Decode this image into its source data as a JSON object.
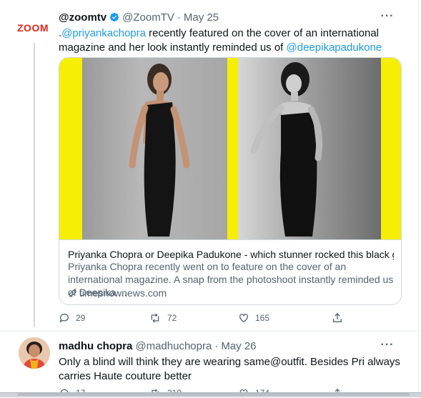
{
  "tweet": {
    "display_name": "@zoomtv",
    "handle": "@ZoomTV",
    "date": "May 25",
    "avatar_text": "ZOOM",
    "text_parts": [
      {
        "text": ".",
        "type": "plain"
      },
      {
        "text": "@priyankachopra",
        "type": "mention"
      },
      {
        "text": " recently featured on the cover of an international magazine and her look instantly reminded us of ",
        "type": "plain"
      },
      {
        "text": "@deepikapadukone",
        "type": "mention"
      }
    ],
    "card": {
      "title": "Priyanka Chopra or Deepika Padukone - which stunner rocked this black gow...",
      "description": "Priyanka Chopra recently went on to feature on the cover of an international magazine. A snap from the photoshoot instantly reminded us of Deepika ...",
      "domain": "timesnownews.com"
    },
    "actions": {
      "replies": "29",
      "retweets": "72",
      "likes": "165"
    }
  },
  "reply": {
    "display_name": "madhu chopra",
    "handle": "@madhuchopra",
    "date": "May 26",
    "text": "Only a blind will think they are wearing same@outfit. Besides Pri always carries Haute couture better",
    "actions": {
      "replies": "17",
      "retweets": "210",
      "likes": "174"
    }
  },
  "more_label": "···",
  "separator": "·",
  "colors": {
    "accent": "#1d9bf0",
    "muted": "#536471",
    "card_bg": "#f6ee04",
    "logo": "#e2231a"
  }
}
